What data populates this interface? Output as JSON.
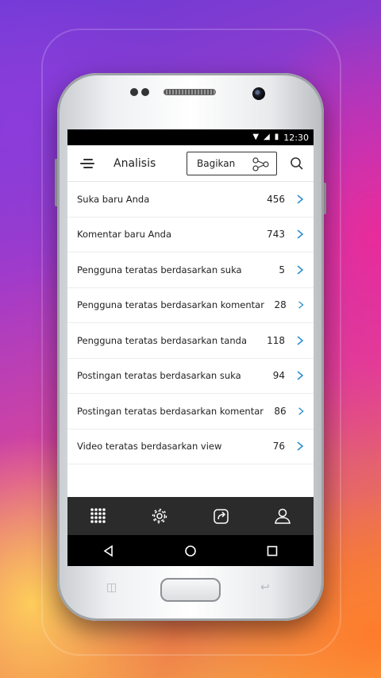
{
  "status_bar": {
    "time": "12:30"
  },
  "app_bar": {
    "title": "Analisis",
    "share_label": "Bagikan"
  },
  "items": [
    {
      "label": "Suka baru Anda",
      "count": "456"
    },
    {
      "label": "Komentar baru Anda",
      "count": "743"
    },
    {
      "label": "Pengguna teratas berdasarkan suka",
      "count": "5"
    },
    {
      "label": "Pengguna teratas berdasarkan komentar",
      "count": "28"
    },
    {
      "label": "Pengguna teratas berdasarkan tanda",
      "count": "118"
    },
    {
      "label": "Postingan teratas berdasarkan suka",
      "count": "94"
    },
    {
      "label": "Postingan teratas berdasarkan komentar",
      "count": "86"
    },
    {
      "label": "Video teratas berdasarkan view",
      "count": "76"
    }
  ],
  "bottom_nav": [
    "grid-icon",
    "gear-icon",
    "share-out-icon",
    "profile-icon"
  ],
  "system_nav": [
    "back-icon",
    "home-icon",
    "recents-icon"
  ],
  "colors": {
    "accent": "#2f8fcf",
    "bottom_nav_bg": "#2b2b2b",
    "text": "#222222"
  }
}
